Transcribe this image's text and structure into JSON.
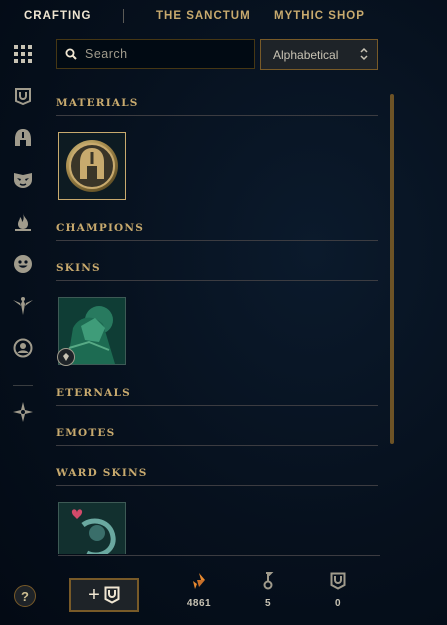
{
  "nav": {
    "tabs": [
      {
        "label": "CRAFTING"
      },
      {
        "label": "THE SANCTUM"
      },
      {
        "label": "MYTHIC SHOP"
      }
    ]
  },
  "sidebar": {
    "items": [
      {
        "icon": "grid-icon"
      },
      {
        "icon": "chest-icon"
      },
      {
        "icon": "helmet-icon"
      },
      {
        "icon": "mask-icon"
      },
      {
        "icon": "flame-icon"
      },
      {
        "icon": "emote-face-icon"
      },
      {
        "icon": "ward-icon"
      },
      {
        "icon": "profile-icon"
      },
      {
        "icon": "mythic-essence-icon"
      }
    ]
  },
  "search": {
    "placeholder": "Search"
  },
  "sort": {
    "selected": "Alphabetical"
  },
  "sections": [
    {
      "title": "MATERIALS"
    },
    {
      "title": "CHAMPIONS"
    },
    {
      "title": "SKINS"
    },
    {
      "title": "ETERNALS"
    },
    {
      "title": "EMOTES"
    },
    {
      "title": "WARD SKINS"
    }
  ],
  "footer": {
    "help_label": "?",
    "add_label": "+",
    "currencies": [
      {
        "icon": "orange-essence-icon",
        "amount": "4861"
      },
      {
        "icon": "key-icon",
        "amount": "5"
      },
      {
        "icon": "chest-icon",
        "amount": "0"
      }
    ]
  },
  "colors": {
    "gold": "#c8aa6e",
    "gold_dark": "#785a28",
    "background": "#06101d",
    "orange_essence": "#e8892f"
  }
}
